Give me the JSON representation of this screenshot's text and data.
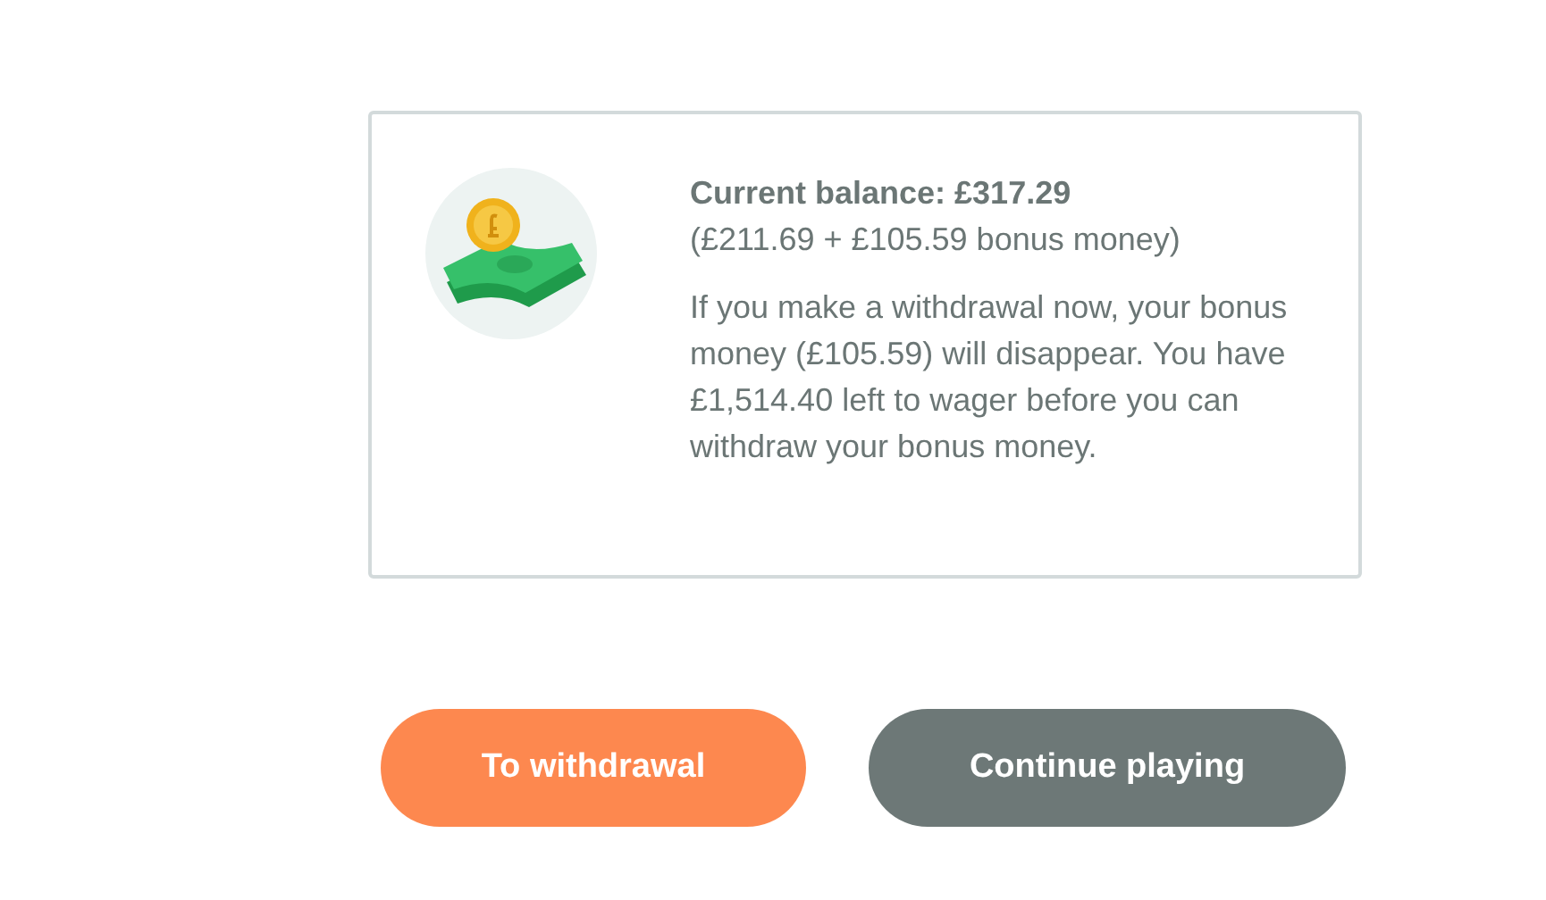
{
  "balance_card": {
    "title": "Current balance: £317.29",
    "breakdown": "(£211.69 + £105.59 bonus money)",
    "message": "If you make a withdrawal now, your bonus money (£105.59) will disappear. You have £1,514.40 left to wager before you can withdraw your bonus money."
  },
  "buttons": [
    {
      "label": "To withdrawal",
      "kind": "primary"
    },
    {
      "label": "Continue playing",
      "kind": "secondary"
    }
  ]
}
